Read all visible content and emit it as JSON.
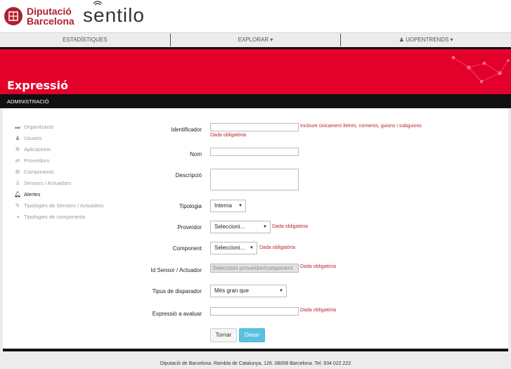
{
  "header": {
    "brand_line1": "Diputació",
    "brand_line2": "Barcelona",
    "product": "sentilo"
  },
  "nav": {
    "items": [
      {
        "label": "ESTADÍSTIQUES"
      },
      {
        "label": "EXPLORAR ▾"
      },
      {
        "label": "UOPENTRENDS ▾"
      }
    ]
  },
  "hero": {
    "title": "Expressió"
  },
  "subbar": {
    "label": "ADMINISTRACIÓ"
  },
  "sidebar": {
    "items": [
      {
        "label": "Organització",
        "icon": "briefcase-icon"
      },
      {
        "label": "Usuaris",
        "icon": "user-icon"
      },
      {
        "label": "Aplicacions",
        "icon": "gear-icon"
      },
      {
        "label": "Proveïdors",
        "icon": "arrows-icon"
      },
      {
        "label": "Components",
        "icon": "gears-icon"
      },
      {
        "label": "Sensors / Actuadors",
        "icon": "sensor-icon"
      },
      {
        "label": "Alertes",
        "icon": "bell-icon"
      },
      {
        "label": "Tipologies de Sensors / Actuadors",
        "icon": "wrench-icon"
      },
      {
        "label": "Tipologies de components",
        "icon": "contrast-icon"
      }
    ]
  },
  "form": {
    "identificador": {
      "label": "Identificador",
      "value": "",
      "hint": "Incloure únicament lletres, números, guions i subguions",
      "error": "Dada obligatòria"
    },
    "nom": {
      "label": "Nom",
      "value": ""
    },
    "descripcio": {
      "label": "Descripció",
      "value": ""
    },
    "tipologia": {
      "label": "Tipologia",
      "value": "Interna"
    },
    "proveidor": {
      "label": "Proveïdor",
      "value": "Seleccioni...",
      "error": "Dada obligatòria"
    },
    "component": {
      "label": "Component",
      "value": "Seleccioni...",
      "error": "Dada obligatòria"
    },
    "sensor": {
      "label": "Id Sensor / Actuador",
      "value": "Seleccioni proveïdor/component",
      "error": "Dada obligatòria"
    },
    "disparador": {
      "label": "Tipus de disparador",
      "value": "Més gran que"
    },
    "expressio": {
      "label": "Expressió a avaluar",
      "value": "",
      "error": "Dada obligatòria"
    },
    "back_label": "Tornar",
    "save_label": "Desar"
  },
  "footer": {
    "text": "Diputació de Barcelona. Rambla de Catalunya, 126. 08008 Barcelona. Tel. 934 022 222"
  },
  "colors": {
    "accent": "#e3002a",
    "error": "#b8252e",
    "primary_button": "#5bc0de"
  }
}
